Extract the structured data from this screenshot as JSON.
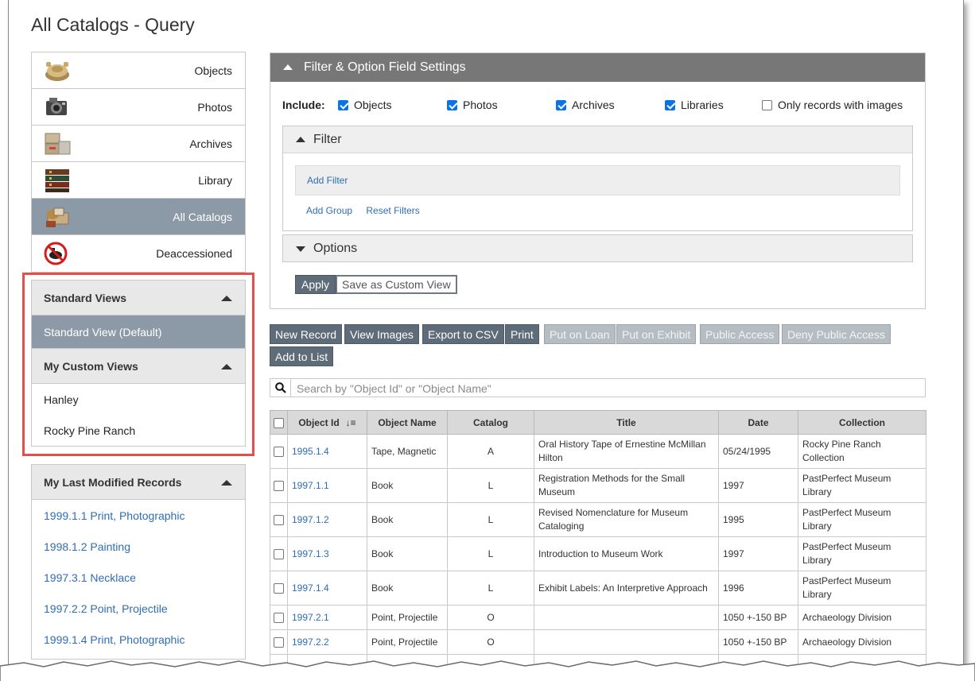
{
  "page_title": "All Catalogs - Query",
  "catalogs": [
    {
      "label": "Objects",
      "icon": "objects-icon",
      "active": false
    },
    {
      "label": "Photos",
      "icon": "camera-icon",
      "active": false
    },
    {
      "label": "Archives",
      "icon": "archive-boxes-icon",
      "active": false
    },
    {
      "label": "Library",
      "icon": "books-icon",
      "active": false
    },
    {
      "label": "All Catalogs",
      "icon": "all-catalogs-icon",
      "active": true
    },
    {
      "label": "Deaccessioned",
      "icon": "deaccessioned-icon",
      "active": false
    }
  ],
  "standard_views": {
    "header": "Standard Views",
    "items": [
      "Standard View (Default)"
    ]
  },
  "custom_views": {
    "header": "My Custom Views",
    "items": [
      "Hanley",
      "Rocky Pine Ranch"
    ]
  },
  "last_modified": {
    "header": "My Last Modified Records",
    "items": [
      "1999.1.1 Print, Photographic",
      "1998.1.2 Painting",
      "1997.3.1 Necklace",
      "1997.2.2 Point, Projectile",
      "1999.1.4 Print, Photographic"
    ]
  },
  "filter_panel": {
    "header": "Filter & Option Field Settings",
    "include_label": "Include:",
    "include_options": [
      {
        "label": "Objects",
        "checked": true
      },
      {
        "label": "Photos",
        "checked": true
      },
      {
        "label": "Archives",
        "checked": true
      },
      {
        "label": "Libraries",
        "checked": true
      },
      {
        "label": "Only records with images",
        "checked": false
      }
    ],
    "filter_header": "Filter",
    "add_filter": "Add Filter",
    "add_group": "Add Group",
    "reset_filters": "Reset Filters",
    "options_header": "Options",
    "apply": "Apply",
    "save_custom_view": "Save as Custom View"
  },
  "toolbar": {
    "new_record": "New Record",
    "view_images": "View Images",
    "export_csv": "Export to CSV",
    "print": "Print",
    "put_on_loan": "Put on Loan",
    "put_on_exhibit": "Put on Exhibit",
    "public_access": "Public Access",
    "deny_public_access": "Deny Public Access",
    "add_to_list": "Add to List"
  },
  "search": {
    "placeholder": "Search by \"Object Id\" or \"Object Name\""
  },
  "table": {
    "columns": [
      "Object Id",
      "Object Name",
      "Catalog",
      "Title",
      "Date",
      "Collection"
    ],
    "rows": [
      {
        "id": "1995.1.4",
        "name": "Tape, Magnetic",
        "catalog": "A",
        "title": "Oral History Tape of Ernestine McMillan Hilton",
        "date": "05/24/1995",
        "collection": "Rocky Pine Ranch Collection"
      },
      {
        "id": "1997.1.1",
        "name": "Book",
        "catalog": "L",
        "title": "Registration Methods for the Small Museum",
        "date": "1997",
        "collection": "PastPerfect Museum Library"
      },
      {
        "id": "1997.1.2",
        "name": "Book",
        "catalog": "L",
        "title": "Revised Nomenclature for Museum Cataloging",
        "date": "1995",
        "collection": "PastPerfect Museum Library"
      },
      {
        "id": "1997.1.3",
        "name": "Book",
        "catalog": "L",
        "title": "Introduction to Museum Work",
        "date": "1997",
        "collection": "PastPerfect Museum Library"
      },
      {
        "id": "1997.1.4",
        "name": "Book",
        "catalog": "L",
        "title": "Exhibit Labels: An Interpretive Approach",
        "date": "1996",
        "collection": "PastPerfect Museum Library"
      },
      {
        "id": "1997.2.1",
        "name": "Point, Projectile",
        "catalog": "O",
        "title": "",
        "date": "1050 +-150 BP",
        "collection": "Archaeology Division"
      },
      {
        "id": "1997.2.2",
        "name": "Point, Projectile",
        "catalog": "O",
        "title": "",
        "date": "1050 +-150 BP",
        "collection": "Archaeology Division"
      }
    ]
  },
  "colors": {
    "accent_active": "#8c9aa8",
    "button_dark": "#5e6b78",
    "link": "#2f6db5",
    "highlight_outline": "#e84d4d"
  }
}
